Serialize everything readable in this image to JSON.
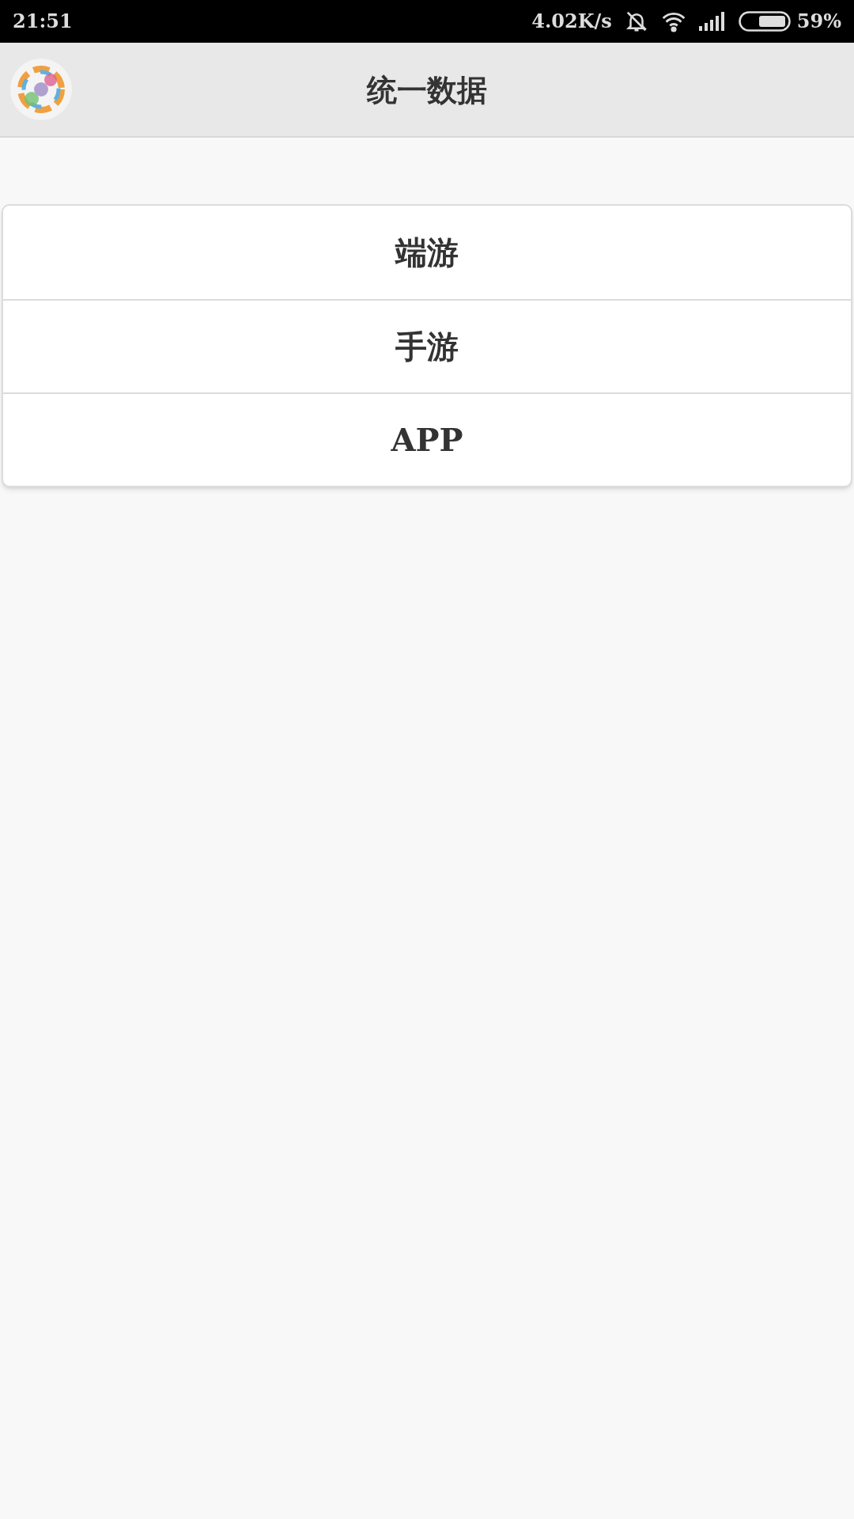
{
  "status_bar": {
    "time": "21:51",
    "speed": "4.02K/s",
    "battery": "59%"
  },
  "header": {
    "title": "统一数据"
  },
  "menu": [
    {
      "label": "端游"
    },
    {
      "label": "手游"
    },
    {
      "label": "APP"
    }
  ]
}
